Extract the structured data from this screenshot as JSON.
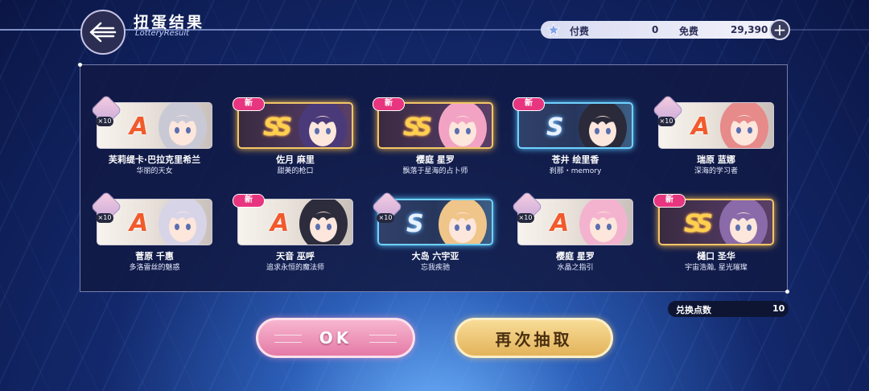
{
  "header": {
    "title": "扭蛋结果",
    "subtitle": "LotteryResult"
  },
  "currency": {
    "paid_label": "付费",
    "paid_value": "0",
    "free_label": "免费",
    "free_value": "29,390"
  },
  "cards": [
    {
      "name": "芙莉缇卡·巴拉克里希兰",
      "title": "华丽的天女",
      "rank": "A",
      "rarity": "rA",
      "badge": "x10",
      "hair": "#c9c9d6"
    },
    {
      "name": "佐月 麻里",
      "title": "甜美的枪口",
      "rank": "SS",
      "rarity": "rSS",
      "badge": "新",
      "hair": "#4b3a7a"
    },
    {
      "name": "樱庭 星罗",
      "title": "飘落于星海的占卜师",
      "rank": "SS",
      "rarity": "rSS",
      "badge": "新",
      "hair": "#f2a3c4"
    },
    {
      "name": "苍井 绘里香",
      "title": "刹那・memory",
      "rank": "S",
      "rarity": "rS",
      "badge": "新",
      "hair": "#2a2a3a"
    },
    {
      "name": "瑞原 蓝娜",
      "title": "深海的学习者",
      "rank": "A",
      "rarity": "rA",
      "badge": "x10",
      "hair": "#e68a8a"
    },
    {
      "name": "菅原 千惠",
      "title": "多洛雷丝的魅惑",
      "rank": "A",
      "rarity": "rA",
      "badge": "x10",
      "hair": "#d8d4e8"
    },
    {
      "name": "天音 巫呼",
      "title": "追求永恒的魔法师",
      "rank": "A",
      "rarity": "rA",
      "badge": "新",
      "hair": "#2c2c3c"
    },
    {
      "name": "大岛 六宇亚",
      "title": "忘我疾驰",
      "rank": "S",
      "rarity": "rS",
      "badge": "x10",
      "hair": "#f0c58a"
    },
    {
      "name": "樱庭 星罗",
      "title": "水晶之指引",
      "rank": "A",
      "rarity": "rA",
      "badge": "x10",
      "hair": "#f3b3cf"
    },
    {
      "name": "樋口 圣华",
      "title": "宇宙浩瀚, 星光璀璨",
      "rank": "SS",
      "rarity": "rSS",
      "badge": "新",
      "hair": "#8a6aa8"
    }
  ],
  "exchange": {
    "label": "兑换点数",
    "value": "10"
  },
  "buttons": {
    "ok_label": "OK",
    "again_label": "再次抽取"
  },
  "colors": {
    "new_badge": "#e8357f",
    "ok_button": "#e57aa7",
    "again_button": "#e3b35a",
    "rank_A": "#f25a2c",
    "rank_SS": "#ffcf4e"
  }
}
